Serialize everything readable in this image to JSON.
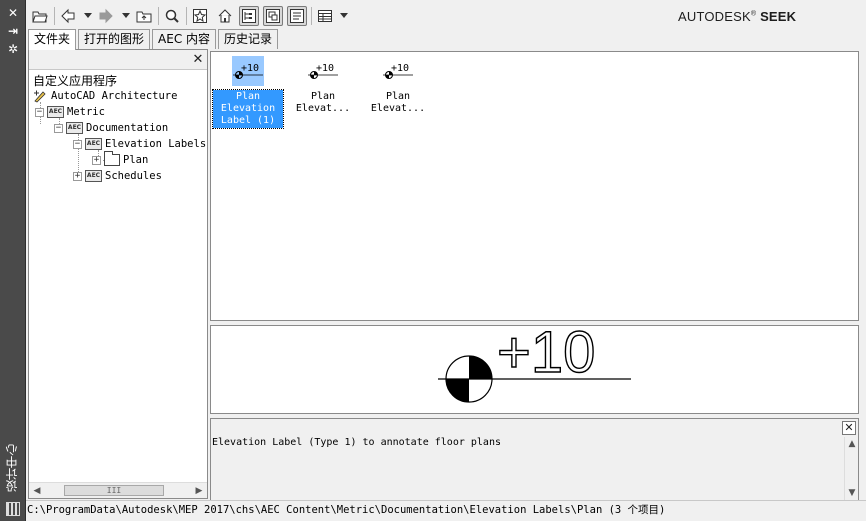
{
  "palette": {
    "title": "设计中心"
  },
  "toolbar": {
    "brand": "AUTODESK",
    "brand_mark": "®",
    "brand_product": "SEEK"
  },
  "tabs": [
    {
      "label": "文件夹",
      "active": true
    },
    {
      "label": "打开的图形",
      "active": false
    },
    {
      "label": "AEC 内容",
      "active": false
    },
    {
      "label": "历史记录",
      "active": false
    }
  ],
  "tree": {
    "root_label": "自定义应用程序",
    "nodes": [
      {
        "label": "AutoCAD Architecture",
        "expander": ""
      },
      {
        "label": "Metric",
        "expander": "−"
      },
      {
        "label": "Documentation",
        "expander": "−"
      },
      {
        "label": "Elevation Labels",
        "expander": "−"
      },
      {
        "label": "Plan",
        "expander": "+"
      },
      {
        "label": "Schedules",
        "expander": "+"
      }
    ]
  },
  "content": {
    "items": [
      {
        "symbol_text": "+10",
        "caption_lines": [
          "Plan",
          "Elevation",
          "Label (1)"
        ],
        "selected": true
      },
      {
        "symbol_text": "+10",
        "caption_lines": [
          "Plan",
          "Elevat..."
        ],
        "selected": false
      },
      {
        "symbol_text": "+10",
        "caption_lines": [
          "Plan",
          "Elevat..."
        ],
        "selected": false
      }
    ]
  },
  "preview": {
    "symbol_text": "+10"
  },
  "description": {
    "text": "Elevation Label (Type 1) to annotate floor plans"
  },
  "status_bar": {
    "path": "C:\\ProgramData\\Autodesk\\MEP 2017\\chs\\AEC Content\\Metric\\Documentation\\Elevation Labels\\Plan (3 个项目)"
  },
  "colors": {
    "selection": "#3399ff",
    "selection_thumb": "#99c9ff",
    "palette_strip": "#4a4a4a"
  }
}
